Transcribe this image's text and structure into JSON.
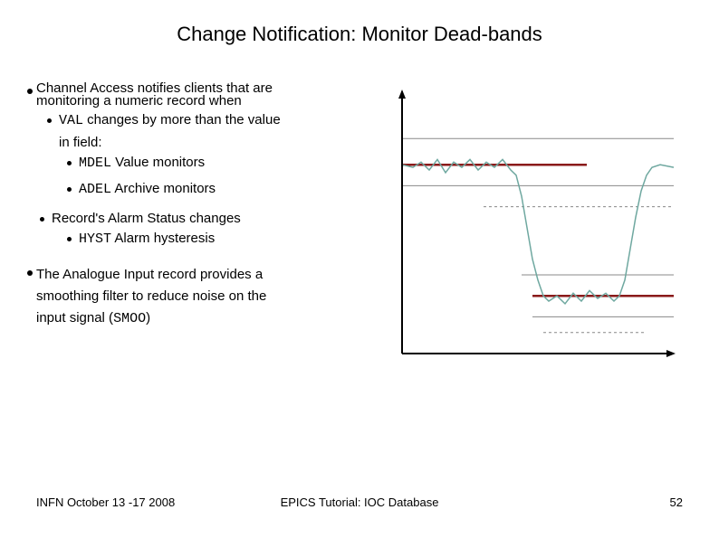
{
  "title": "Change Notification: Monitor Dead-bands",
  "text": {
    "top_line1": "Channel Access notifies clients that are",
    "top_line2": "monitoring a numeric record when",
    "val_code": "VAL",
    "val_line1": " changes by more than the value",
    "val_line2": "in field:",
    "mdel_code": "MDEL",
    "mdel_text": "  Value monitors",
    "adel_code": "ADEL",
    "adel_text": "  Archive monitors",
    "alarm_line1": "Record's Alarm Status changes",
    "hyst_code": "HYST",
    "hyst_text": "  Alarm hysteresis",
    "para2_line1": "The Analogue Input record provides a",
    "para2_line2": "smoothing filter to reduce noise on the",
    "para2_line3a": "input signal (",
    "smoo_code": "SMOO",
    "para2_line3b": ")"
  },
  "footer": {
    "left": "INFN October 13 -17 2008",
    "center": "EPICS Tutorial: IOC Database",
    "right": "52"
  },
  "chart_data": {
    "type": "line",
    "title": "",
    "xlabel": "",
    "ylabel": "",
    "xlim": [
      0,
      100
    ],
    "ylim": [
      0,
      100
    ],
    "series": [
      {
        "name": "signal",
        "color": "#6fa8a0",
        "points": [
          [
            0,
            72
          ],
          [
            4,
            71
          ],
          [
            7,
            73
          ],
          [
            10,
            70
          ],
          [
            13,
            74
          ],
          [
            16,
            69
          ],
          [
            19,
            73
          ],
          [
            22,
            71
          ],
          [
            25,
            74
          ],
          [
            28,
            70
          ],
          [
            31,
            73
          ],
          [
            34,
            71
          ],
          [
            37,
            74
          ],
          [
            40,
            70
          ],
          [
            42,
            68
          ],
          [
            44,
            60
          ],
          [
            46,
            48
          ],
          [
            48,
            36
          ],
          [
            50,
            28
          ],
          [
            52,
            22
          ],
          [
            54,
            20
          ],
          [
            57,
            22
          ],
          [
            60,
            19
          ],
          [
            63,
            23
          ],
          [
            66,
            20
          ],
          [
            69,
            24
          ],
          [
            72,
            21
          ],
          [
            75,
            23
          ],
          [
            78,
            20
          ],
          [
            80,
            22
          ],
          [
            82,
            28
          ],
          [
            84,
            40
          ],
          [
            86,
            52
          ],
          [
            88,
            62
          ],
          [
            90,
            68
          ],
          [
            92,
            71
          ],
          [
            95,
            72
          ],
          [
            100,
            71
          ]
        ]
      }
    ],
    "threshold_lines": [
      {
        "y": 82,
        "color": "#888",
        "dash": false,
        "span": [
          0,
          100
        ]
      },
      {
        "y": 72,
        "color": "#8a1a1a",
        "dash": false,
        "span": [
          0,
          68
        ],
        "thick": true
      },
      {
        "y": 64,
        "color": "#888",
        "dash": false,
        "span": [
          0,
          100
        ]
      },
      {
        "y": 56,
        "color": "#888",
        "dash": true,
        "span": [
          30,
          100
        ]
      },
      {
        "y": 30,
        "color": "#888",
        "dash": false,
        "span": [
          44,
          100
        ]
      },
      {
        "y": 22,
        "color": "#8a1a1a",
        "dash": false,
        "span": [
          48,
          100
        ],
        "thick": true
      },
      {
        "y": 14,
        "color": "#888",
        "dash": false,
        "span": [
          48,
          100
        ]
      },
      {
        "y": 8,
        "color": "#888",
        "dash": true,
        "span": [
          52,
          90
        ]
      }
    ]
  }
}
